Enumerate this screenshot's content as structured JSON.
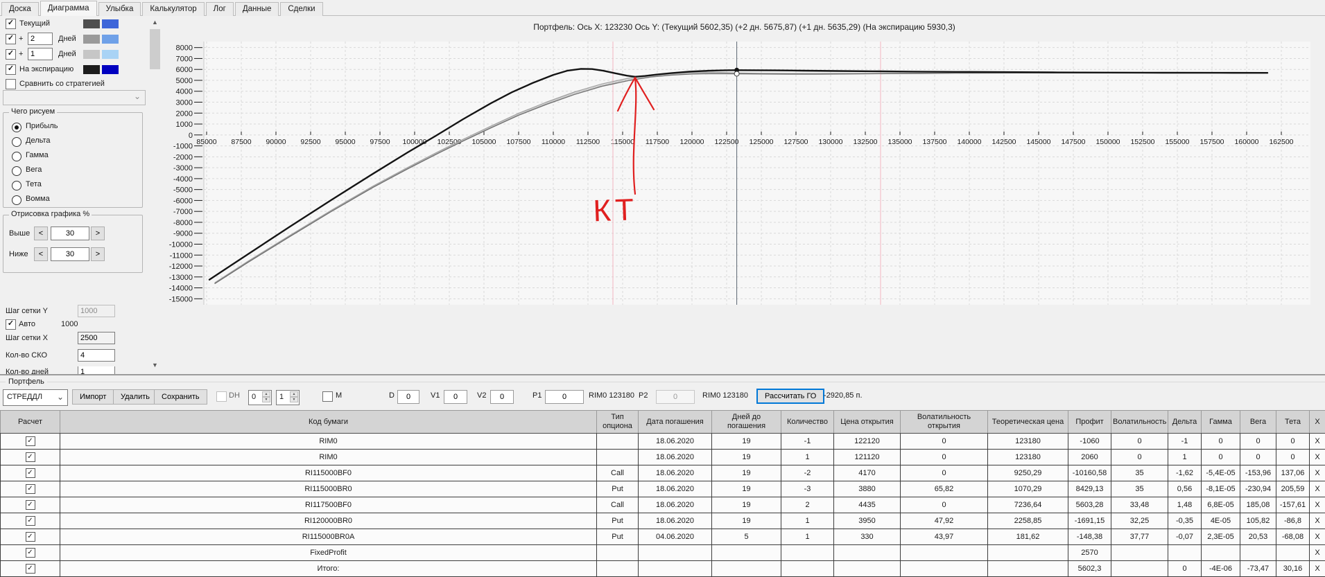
{
  "tabs": {
    "items": [
      "Доска",
      "Диаграмма",
      "Улыбка",
      "Калькулятор",
      "Лог",
      "Данные",
      "Сделки"
    ],
    "active": "Диаграмма"
  },
  "sidebar": {
    "rows": [
      {
        "label": "Текущий",
        "checked": true,
        "swatch1": "#4f4f4f",
        "swatch2": "#3e66d9"
      },
      {
        "prefix": "+",
        "value": "2",
        "label": "Дней",
        "checked": true,
        "swatch1": "#9a9a9a",
        "swatch2": "#6fa1e8"
      },
      {
        "prefix": "+",
        "value": "1",
        "label": "Дней",
        "checked": true,
        "swatch1": "#c6c6c6",
        "swatch2": "#a9d3f5"
      },
      {
        "label": "На экспирацию",
        "checked": true,
        "swatch1": "#1c1c1c",
        "swatch2": "#0000c0"
      },
      {
        "label": "Сравнить со стратегией",
        "checked": false
      }
    ],
    "draw_group": {
      "title": "Чего рисуем",
      "options": [
        "Прибыль",
        "Дельта",
        "Гамма",
        "Вега",
        "Тета",
        "Вомма"
      ],
      "selected": "Прибыль"
    },
    "render_group": {
      "title": "Отрисовка графика %",
      "above_label": "Выше",
      "above_value": "30",
      "below_label": "Ниже",
      "below_value": "30"
    },
    "grid_y_label": "Шаг сетки Y",
    "grid_y_value": "1000",
    "auto_label": "Авто",
    "auto_checked": true,
    "auto_value": "1000",
    "grid_x_label": "Шаг сетки X",
    "grid_x_value": "2500",
    "sko_label": "Кол-во СКО",
    "sko_value": "4",
    "days_label": "Кол-во дней",
    "days_value": "1"
  },
  "chart_data": {
    "type": "line",
    "title": "Портфель: Ось X: 123230 Ось Y:  (Текущий 5602,35)  (+2 дн. 5675,87)  (+1 дн. 5635,29)  (На экспирацию 5930,3)",
    "x_axis": {
      "min": 85000,
      "max": 162500,
      "step": 2500
    },
    "y_axis": {
      "min": -15000,
      "max": 8000,
      "step": 1000
    },
    "grid": "dashed",
    "cursor": {
      "x": 123230,
      "color": "#5a6470",
      "points": [
        {
          "y": 5930.3,
          "style": "filled"
        },
        {
          "y": 5602.35,
          "style": "open"
        }
      ]
    },
    "guide_lines": [
      {
        "x": 114300,
        "color": "#f3b6c0"
      },
      {
        "x": 133600,
        "color": "#f3b6c0"
      }
    ],
    "series": [
      {
        "name": "+1 Дней",
        "color": "#c4c4c4",
        "width": 1.2,
        "points": [
          [
            85600,
            -13560
          ],
          [
            88000,
            -11600
          ],
          [
            91000,
            -9250
          ],
          [
            94000,
            -6950
          ],
          [
            97000,
            -4740
          ],
          [
            99500,
            -3040
          ],
          [
            101500,
            -1730
          ],
          [
            103500,
            -480
          ],
          [
            105500,
            730
          ],
          [
            107500,
            1890
          ],
          [
            109500,
            2900
          ],
          [
            111500,
            3810
          ],
          [
            113500,
            4560
          ],
          [
            115500,
            5110
          ],
          [
            117000,
            5400
          ],
          [
            118500,
            5570
          ],
          [
            120000,
            5660
          ],
          [
            121500,
            5680
          ],
          [
            123230,
            5635
          ],
          [
            125000,
            5612
          ],
          [
            127000,
            5596
          ],
          [
            129000,
            5593
          ],
          [
            131500,
            5605
          ],
          [
            134000,
            5626
          ],
          [
            136500,
            5646
          ],
          [
            139000,
            5664
          ],
          [
            142000,
            5678
          ],
          [
            145000,
            5686
          ],
          [
            148000,
            5690
          ],
          [
            152000,
            5689
          ],
          [
            156000,
            5684
          ],
          [
            160000,
            5678
          ],
          [
            161500,
            5676
          ]
        ]
      },
      {
        "name": "+2 Дней",
        "color": "#9e9e9e",
        "width": 1.2,
        "points": [
          [
            85600,
            -13520
          ],
          [
            88000,
            -11550
          ],
          [
            91000,
            -9200
          ],
          [
            94000,
            -6890
          ],
          [
            97000,
            -4680
          ],
          [
            99500,
            -2980
          ],
          [
            101500,
            -1660
          ],
          [
            103500,
            -400
          ],
          [
            105500,
            810
          ],
          [
            107500,
            1980
          ],
          [
            109500,
            3000
          ],
          [
            111500,
            3920
          ],
          [
            113500,
            4670
          ],
          [
            115500,
            5220
          ],
          [
            117000,
            5500
          ],
          [
            118500,
            5660
          ],
          [
            120000,
            5740
          ],
          [
            121500,
            5745
          ],
          [
            123230,
            5676
          ],
          [
            125000,
            5646
          ],
          [
            127000,
            5624
          ],
          [
            129000,
            5617
          ],
          [
            131500,
            5625
          ],
          [
            134000,
            5642
          ],
          [
            136500,
            5658
          ],
          [
            139000,
            5672
          ],
          [
            142000,
            5683
          ],
          [
            145000,
            5689
          ],
          [
            148000,
            5691
          ],
          [
            152000,
            5689
          ],
          [
            156000,
            5684
          ],
          [
            160000,
            5678
          ],
          [
            161500,
            5676
          ]
        ]
      },
      {
        "name": "Текущий",
        "color": "#707070",
        "width": 1.4,
        "points": [
          [
            85600,
            -13600
          ],
          [
            88000,
            -11650
          ],
          [
            91000,
            -9300
          ],
          [
            94000,
            -7000
          ],
          [
            97000,
            -4800
          ],
          [
            99500,
            -3100
          ],
          [
            101500,
            -1800
          ],
          [
            103500,
            -550
          ],
          [
            105500,
            650
          ],
          [
            107500,
            1800
          ],
          [
            109500,
            2800
          ],
          [
            111500,
            3700
          ],
          [
            113500,
            4450
          ],
          [
            115500,
            5000
          ],
          [
            117000,
            5300
          ],
          [
            118500,
            5480
          ],
          [
            120000,
            5580
          ],
          [
            121500,
            5615
          ],
          [
            123230,
            5602
          ],
          [
            125000,
            5585
          ],
          [
            127000,
            5572
          ],
          [
            129000,
            5572
          ],
          [
            131500,
            5588
          ],
          [
            134000,
            5612
          ],
          [
            136500,
            5635
          ],
          [
            139000,
            5655
          ],
          [
            142000,
            5672
          ],
          [
            145000,
            5682
          ],
          [
            148000,
            5687
          ],
          [
            152000,
            5688
          ],
          [
            156000,
            5684
          ],
          [
            160000,
            5678
          ],
          [
            161500,
            5676
          ]
        ]
      },
      {
        "name": "На экспирацию",
        "color": "#141414",
        "width": 2.4,
        "points": [
          [
            85200,
            -13250
          ],
          [
            88000,
            -10900
          ],
          [
            91000,
            -8400
          ],
          [
            94000,
            -5950
          ],
          [
            97000,
            -3550
          ],
          [
            99500,
            -1600
          ],
          [
            101500,
            -100
          ],
          [
            103500,
            1450
          ],
          [
            105500,
            2900
          ],
          [
            107000,
            3900
          ],
          [
            108500,
            4750
          ],
          [
            110000,
            5500
          ],
          [
            111000,
            5880
          ],
          [
            112000,
            6050
          ],
          [
            112800,
            6030
          ],
          [
            113600,
            5880
          ],
          [
            114500,
            5640
          ],
          [
            115300,
            5430
          ],
          [
            115900,
            5330
          ],
          [
            116600,
            5400
          ],
          [
            117500,
            5530
          ],
          [
            118500,
            5660
          ],
          [
            119800,
            5790
          ],
          [
            121200,
            5880
          ],
          [
            122500,
            5925
          ],
          [
            123230,
            5930
          ],
          [
            124500,
            5925
          ],
          [
            126000,
            5910
          ],
          [
            128000,
            5885
          ],
          [
            130500,
            5855
          ],
          [
            133000,
            5830
          ],
          [
            136000,
            5800
          ],
          [
            139000,
            5775
          ],
          [
            142500,
            5750
          ],
          [
            146000,
            5730
          ],
          [
            150000,
            5710
          ],
          [
            154000,
            5695
          ],
          [
            158000,
            5688
          ],
          [
            161500,
            5683
          ]
        ]
      }
    ],
    "annotation": {
      "text": "КТ",
      "color": "#e02020",
      "arrow_x": 115900,
      "tip_y": 5250,
      "tail_y": -5400,
      "text_x": 112900,
      "text_y": -7900
    }
  },
  "portfolio": {
    "group_label": "Портфель",
    "toolbar": {
      "strategy_value": "СТРЕДДЛ",
      "import_label": "Импорт",
      "delete_label": "Удалить",
      "save_label": "Сохранить",
      "dh_label": "DH",
      "dh_spin1": "0",
      "dh_spin2": "1",
      "m_label": "M",
      "d_label": "D",
      "d_value": "0",
      "v1_label": "V1",
      "v1_value": "0",
      "v2_label": "V2",
      "v2_value": "0",
      "p1_label": "P1",
      "p1_value": "0",
      "p1_hint": "RIM0 123180",
      "p2_label": "P2",
      "p2_value": "0",
      "p2_hint": "RIM0 123180",
      "calc_go_label": "Рассчитать ГО",
      "go_value": "-2920,85 п."
    },
    "table": {
      "headers": [
        "Расчет",
        "Код бумаги",
        "Тип опциона",
        "Дата погашения",
        "Дней до погашения",
        "Количество",
        "Цена открытия",
        "Волатильность открытия",
        "Теоретическая цена",
        "Профит",
        "Волатильность",
        "Дельта",
        "Гамма",
        "Вега",
        "Тета",
        "X"
      ],
      "close_label": "X",
      "rows": [
        {
          "checked": true,
          "selected": false,
          "profit_state": "neg",
          "cells": [
            "RIM0",
            "",
            "18.06.2020",
            "19",
            "-1",
            "122120",
            "0",
            "123180",
            "-1060",
            "0",
            "-1",
            "0",
            "0",
            "0"
          ]
        },
        {
          "checked": true,
          "selected": false,
          "profit_state": "pos",
          "cells": [
            "RIM0",
            "",
            "18.06.2020",
            "19",
            "1",
            "121120",
            "0",
            "123180",
            "2060",
            "0",
            "1",
            "0",
            "0",
            "0"
          ]
        },
        {
          "checked": true,
          "selected": false,
          "profit_state": "neg",
          "cells": [
            "RI115000BF0",
            "Call",
            "18.06.2020",
            "19",
            "-2",
            "4170",
            "0",
            "9250,29",
            "-10160,58",
            "35",
            "-1,62",
            "-5,4E-05",
            "-153,96",
            "137,06"
          ]
        },
        {
          "checked": true,
          "selected": false,
          "profit_state": "pos",
          "cells": [
            "RI115000BR0",
            "Put",
            "18.06.2020",
            "19",
            "-3",
            "3880",
            "65,82",
            "1070,29",
            "8429,13",
            "35",
            "0,56",
            "-8,1E-05",
            "-230,94",
            "205,59"
          ]
        },
        {
          "checked": true,
          "selected": false,
          "profit_state": "pos",
          "cells": [
            "RI117500BF0",
            "Call",
            "18.06.2020",
            "19",
            "2",
            "4435",
            "0",
            "7236,64",
            "5603,28",
            "33,48",
            "1,48",
            "6,8E-05",
            "185,08",
            "-157,61"
          ]
        },
        {
          "checked": true,
          "selected": false,
          "profit_state": "neg",
          "cells": [
            "RI120000BR0",
            "Put",
            "18.06.2020",
            "19",
            "1",
            "3950",
            "47,92",
            "2258,85",
            "-1691,15",
            "32,25",
            "-0,35",
            "4E-05",
            "105,82",
            "-86,8"
          ]
        },
        {
          "checked": true,
          "selected": true,
          "profit_state": "neg",
          "cells": [
            "RI115000BR0A",
            "Put",
            "04.06.2020",
            "5",
            "1",
            "330",
            "43,97",
            "181,62",
            "-148,38",
            "37,77",
            "-0,07",
            "2,3E-05",
            "20,53",
            "-68,08"
          ]
        },
        {
          "checked": true,
          "selected": false,
          "profit_state": "pos",
          "cells": [
            "FixedProfit",
            "",
            "",
            "",
            "",
            "",
            "",
            "",
            "2570",
            "",
            "",
            "",
            "",
            ""
          ]
        },
        {
          "checked": true,
          "selected": false,
          "profit_state": "pos",
          "cells": [
            "Итого:",
            "",
            "",
            "",
            "",
            "",
            "",
            "",
            "5602,3",
            "",
            "0",
            "-4E-06",
            "-73,47",
            "30,16"
          ]
        }
      ]
    }
  }
}
